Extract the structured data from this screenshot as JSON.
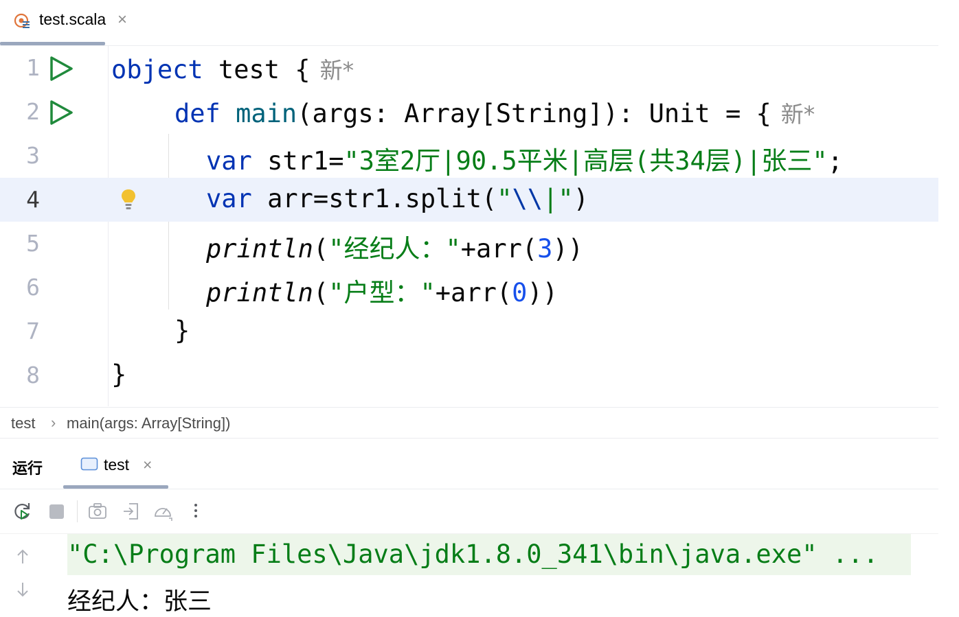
{
  "editor_tab": {
    "filename": "test.scala",
    "close_glyph": "×"
  },
  "code": {
    "lines": [
      {
        "num": "1",
        "tokens": {
          "kw": "object",
          "name": " test {",
          "hint": "新*"
        }
      },
      {
        "num": "2",
        "tokens": {
          "kw": "def",
          "fn": " main",
          "rest": "(args: Array[String]): Unit = {",
          "hint": "新*"
        }
      },
      {
        "num": "3",
        "tokens": {
          "kw": "var",
          "rest": " str1=",
          "str": "\"3室2厅|90.5平米|高层(共34层)|张三\"",
          "end": ";"
        }
      },
      {
        "num": "4",
        "tokens": {
          "kw": "var",
          "rest": " arr=str1.split(",
          "str_open": "\"",
          "esc": "\\\\",
          "str_mid": "|",
          "str_close": "\"",
          "end": ")"
        }
      },
      {
        "num": "5",
        "tokens": {
          "fn": "println",
          "open": "(",
          "str": "\"经纪人：\"",
          "rest": "+arr(",
          "num": "3",
          "end": "))"
        }
      },
      {
        "num": "6",
        "tokens": {
          "fn": "println",
          "open": "(",
          "str": "\"户型：\"",
          "rest": "+arr(",
          "num": "0",
          "end": "))"
        }
      },
      {
        "num": "7",
        "tokens": {
          "rest": "}"
        }
      },
      {
        "num": "8",
        "tokens": {
          "rest": "}"
        }
      }
    ]
  },
  "breadcrumb": {
    "items": [
      "test",
      "main(args: Array[String])"
    ],
    "separator": "›"
  },
  "run_window": {
    "title": "运行",
    "tab_label": "test",
    "close_glyph": "×",
    "toolbar": [
      "rerun-icon",
      "stop-icon",
      "camera-icon",
      "exit-icon",
      "speedometer-icon",
      "more-vertical-icon"
    ],
    "console": {
      "command": "\"C:\\Program Files\\Java\\jdk1.8.0_341\\bin\\java.exe\" ...",
      "output": "经纪人：张三"
    }
  },
  "colors": {
    "keyword": "#0033b3",
    "string": "#067d17",
    "number": "#1750eb",
    "current_line": "#edf2fc",
    "run_green": "#208a3c",
    "bulb": "#f2c130"
  }
}
